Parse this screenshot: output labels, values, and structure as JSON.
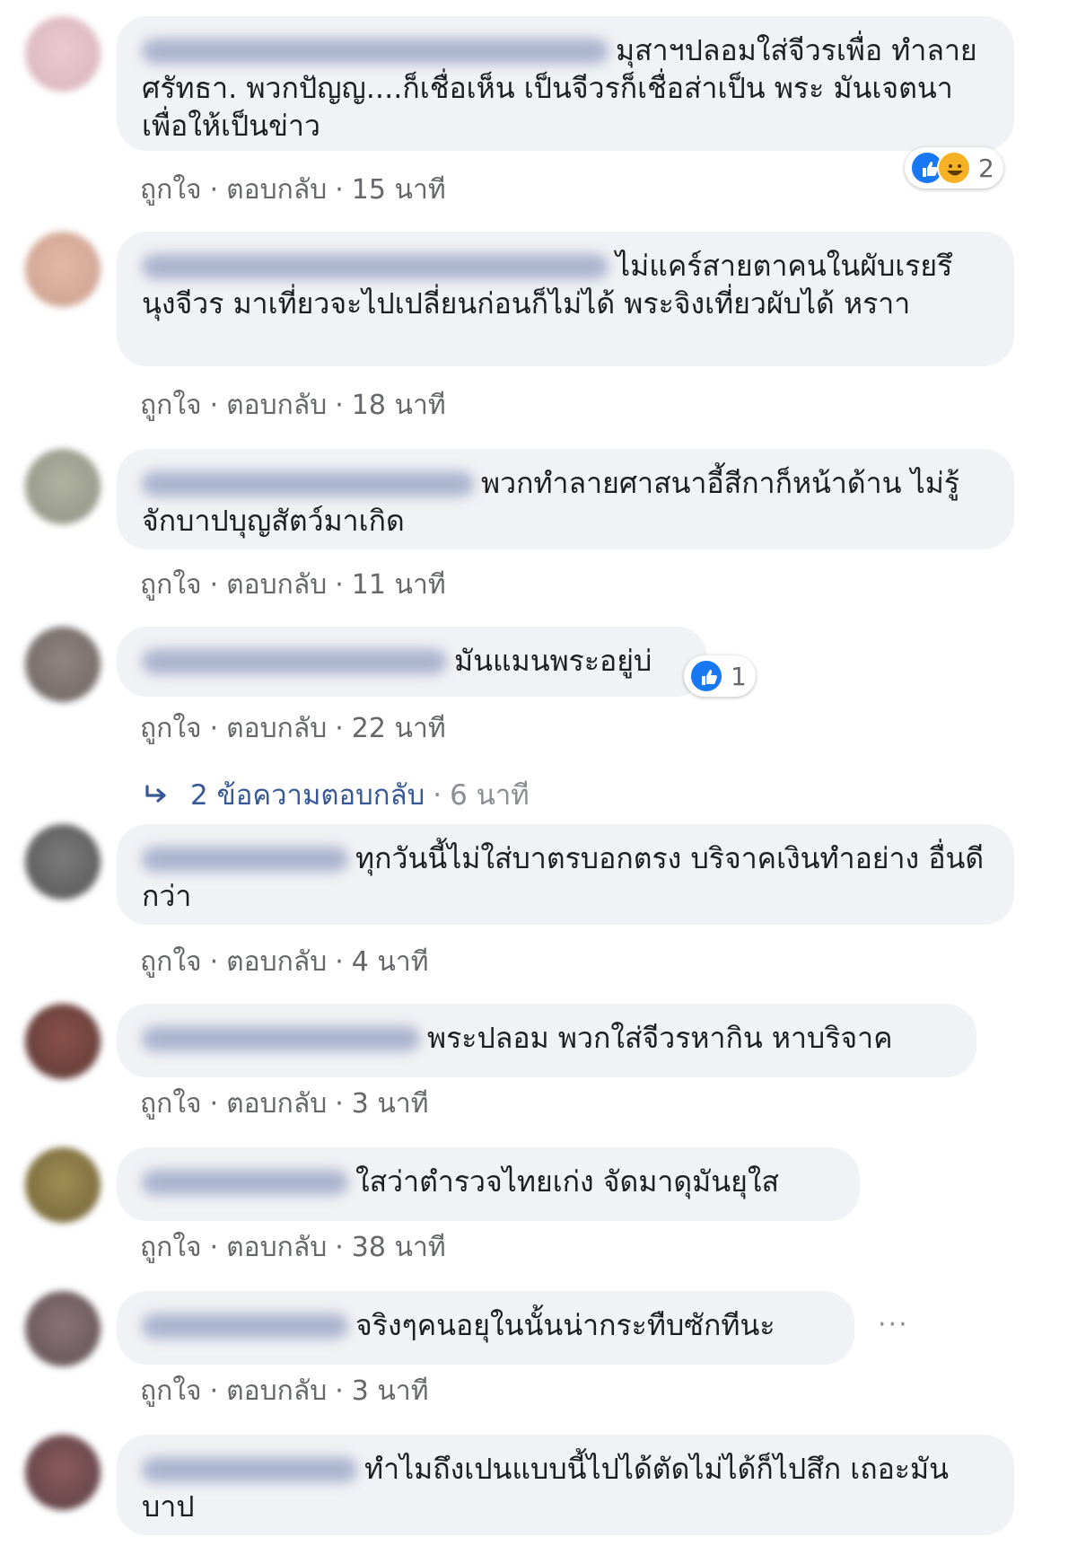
{
  "actions": {
    "like": "ถูกใจ",
    "reply": "ตอบกลับ",
    "dot": "·"
  },
  "comments": [
    {
      "text": "มุสาฯปลอมใส่จีวรเพื่อ ทำลายศรัทธา. พวกปัญญ....ก็เชื่อเห็น เป็นจีวรก็เชื่อส่าเป็น พระ มันเจตนาเพื่อให้เป็นข่าว",
      "time": "15 นาที",
      "reactions": "2"
    },
    {
      "text": "ไม่แคร์สายตาคนในผับเรยรึ นุงจีวร มาเที่ยวจะไปเปลี่ยนก่อนก็ไม่ได้ พระจิงเที่ยวผับได้ หราา",
      "time": "18 นาที"
    },
    {
      "text": "พวกทำลายศาสนาอี้สีกาก็หน้าด้าน ไม่รู้จักบาปบุญสัตว์มาเกิด",
      "time": "11 นาที"
    },
    {
      "text": "มันแมนพระอยู่บ่",
      "time": "22 นาที",
      "reactions": "1"
    },
    {
      "text": "ทุกวันนี้ไม่ใส่บาตรบอกตรง บริจาคเงินทำอย่าง อื่นดีกว่า",
      "time": "4 นาที"
    },
    {
      "text": "พระปลอม พวกใส่จีวรหากิน หาบริจาค",
      "time": "3 นาที"
    },
    {
      "text": "ใสว่าตำรวจไทยเก่ง จัดมาดุมันยุใส",
      "time": "38 นาที"
    },
    {
      "text": "จริงๆคนอยุในนั้นน่ากระทืบซักทีนะ",
      "time": "3 นาที",
      "more": "···"
    },
    {
      "text": "ทำไมถึงเปนแบบนี้ไปได้ตัดไม่ได้ก็ไปสึก เถอะมันบาป"
    }
  ],
  "replies": {
    "count_label": "2 ข้อความตอบกลับ",
    "time": "6 นาที"
  },
  "colors": {
    "bubble": "#f0f2f5",
    "meta": "#65676b",
    "link": "#385898",
    "like": "#1877f2",
    "haha": "#f7b125"
  },
  "icons": {
    "like": "like-icon",
    "haha": "haha-icon",
    "reply_arrow": "reply-arrow-icon",
    "more": "more-options-icon"
  }
}
